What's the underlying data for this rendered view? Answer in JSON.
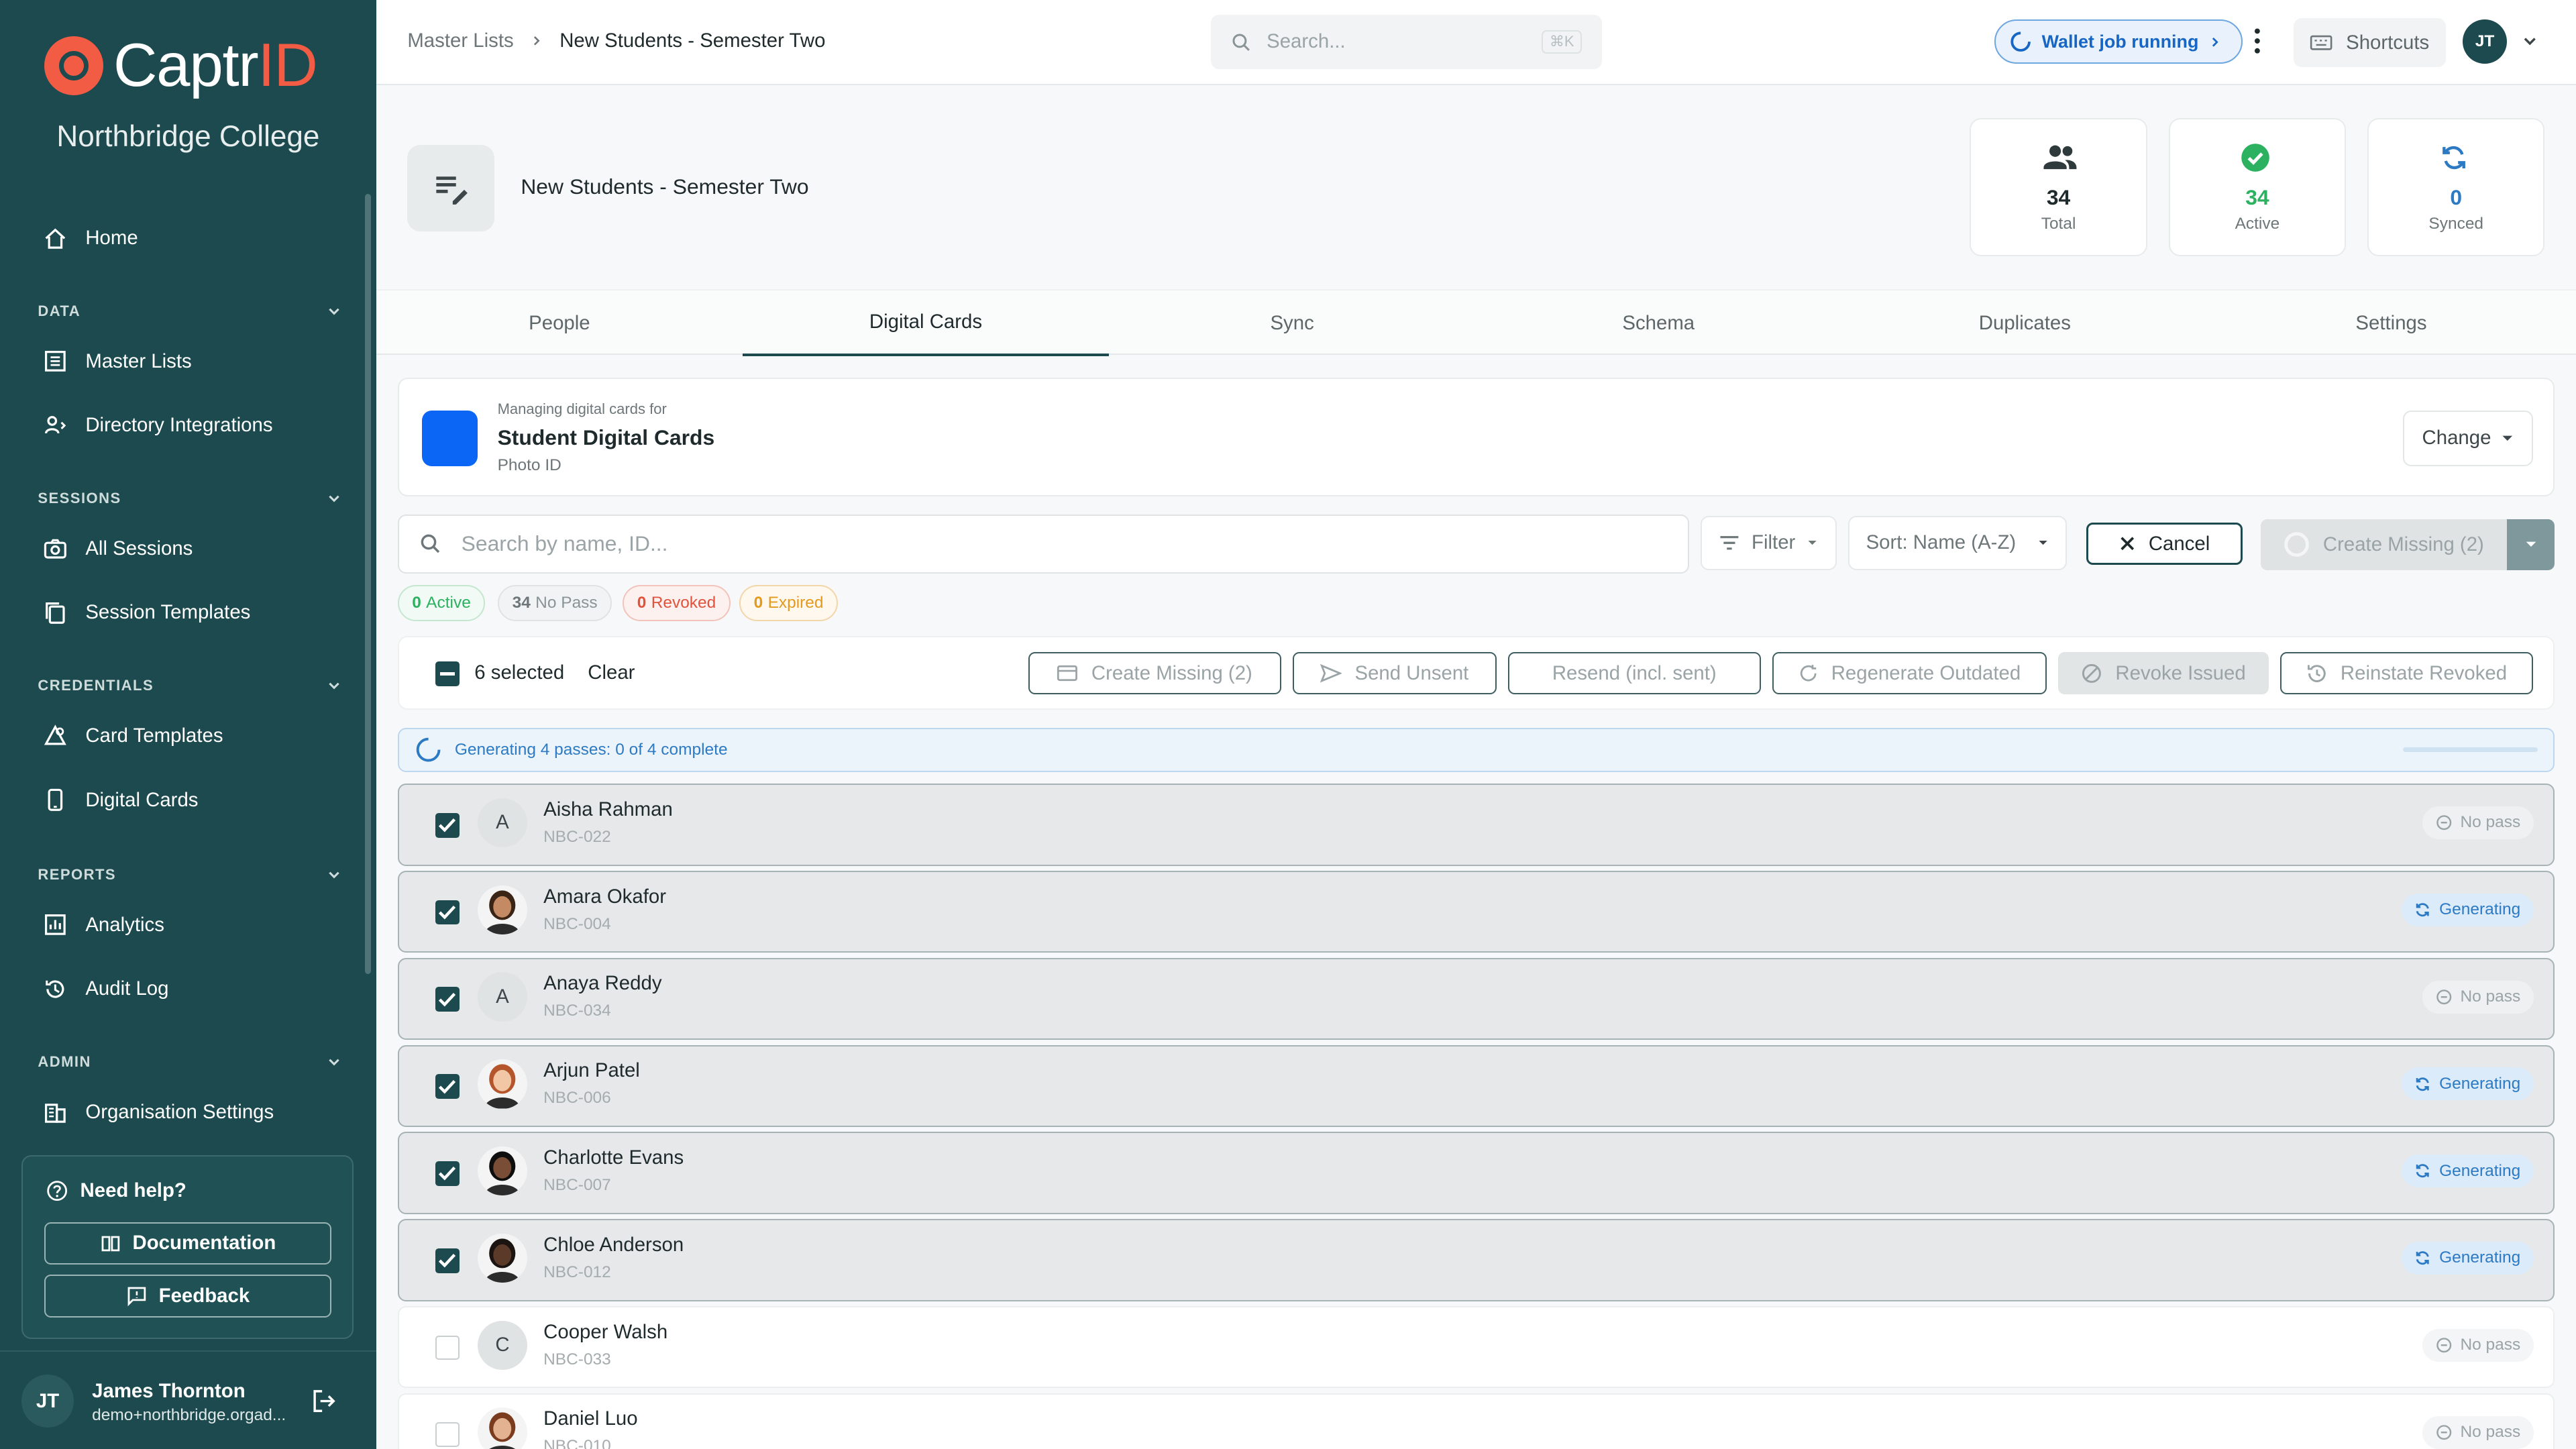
{
  "brand": {
    "name_main": "Captr",
    "name_accent": "ID",
    "org": "Northbridge College"
  },
  "sidebar": {
    "home": "Home",
    "sections": [
      {
        "label": "DATA",
        "items": [
          "Master Lists",
          "Directory Integrations"
        ]
      },
      {
        "label": "SESSIONS",
        "items": [
          "All Sessions",
          "Session Templates"
        ]
      },
      {
        "label": "CREDENTIALS",
        "items": [
          "Card Templates",
          "Digital Cards"
        ]
      },
      {
        "label": "REPORTS",
        "items": [
          "Analytics",
          "Audit Log"
        ]
      },
      {
        "label": "ADMIN",
        "items": [
          "Organisation Settings"
        ]
      }
    ],
    "help": {
      "title": "Need help?",
      "docs": "Documentation",
      "feedback": "Feedback"
    },
    "user": {
      "initials": "JT",
      "name": "James Thornton",
      "email": "demo+northbridge.orgad..."
    }
  },
  "topbar": {
    "breadcrumb": [
      "Master Lists",
      "New Students - Semester Two"
    ],
    "search_placeholder": "Search...",
    "search_shortcut": "⌘K",
    "wallet_status": "Wallet job running",
    "shortcuts": "Shortcuts",
    "avatar": "JT"
  },
  "header": {
    "title": "New Students - Semester Two",
    "stats": [
      {
        "value": "34",
        "label": "Total"
      },
      {
        "value": "34",
        "label": "Active"
      },
      {
        "value": "0",
        "label": "Synced"
      }
    ]
  },
  "tabs": [
    "People",
    "Digital Cards",
    "Sync",
    "Schema",
    "Duplicates",
    "Settings"
  ],
  "active_tab": "Digital Cards",
  "card": {
    "managing": "Managing digital cards for",
    "name": "Student Digital Cards",
    "subtitle": "Photo ID",
    "change": "Change",
    "color": "#0b66f5"
  },
  "toolbar": {
    "search_placeholder": "Search by name, ID...",
    "filter": "Filter",
    "sort": "Sort: Name (A-Z)",
    "cancel": "Cancel",
    "create_missing": "Create Missing (2)"
  },
  "chips": [
    {
      "count": "0",
      "label": "Active"
    },
    {
      "count": "34",
      "label": "No Pass"
    },
    {
      "count": "0",
      "label": "Revoked"
    },
    {
      "count": "0",
      "label": "Expired"
    }
  ],
  "bulk": {
    "selected": "6 selected",
    "clear": "Clear",
    "actions": [
      "Create Missing (2)",
      "Send Unsent",
      "Resend (incl. sent)",
      "Regenerate Outdated",
      "Revoke Issued",
      "Reinstate Revoked"
    ]
  },
  "progress": {
    "text": "Generating 4 passes: 0 of 4 complete",
    "fraction": 0.0
  },
  "rows": [
    {
      "name": "Aisha Rahman",
      "id": "NBC-022",
      "initial": "A",
      "photo": false,
      "selected": true,
      "status": "No pass"
    },
    {
      "name": "Amara Okafor",
      "id": "NBC-004",
      "initial": "",
      "photo": true,
      "selected": true,
      "status": "Generating"
    },
    {
      "name": "Anaya Reddy",
      "id": "NBC-034",
      "initial": "A",
      "photo": false,
      "selected": true,
      "status": "No pass"
    },
    {
      "name": "Arjun Patel",
      "id": "NBC-006",
      "initial": "",
      "photo": true,
      "selected": true,
      "status": "Generating"
    },
    {
      "name": "Charlotte Evans",
      "id": "NBC-007",
      "initial": "",
      "photo": true,
      "selected": true,
      "status": "Generating"
    },
    {
      "name": "Chloe Anderson",
      "id": "NBC-012",
      "initial": "",
      "photo": true,
      "selected": true,
      "status": "Generating"
    },
    {
      "name": "Cooper Walsh",
      "id": "NBC-033",
      "initial": "C",
      "photo": false,
      "selected": false,
      "status": "No pass"
    },
    {
      "name": "Daniel Luo",
      "id": "NBC-010",
      "initial": "",
      "photo": true,
      "selected": false,
      "status": "No pass"
    }
  ]
}
